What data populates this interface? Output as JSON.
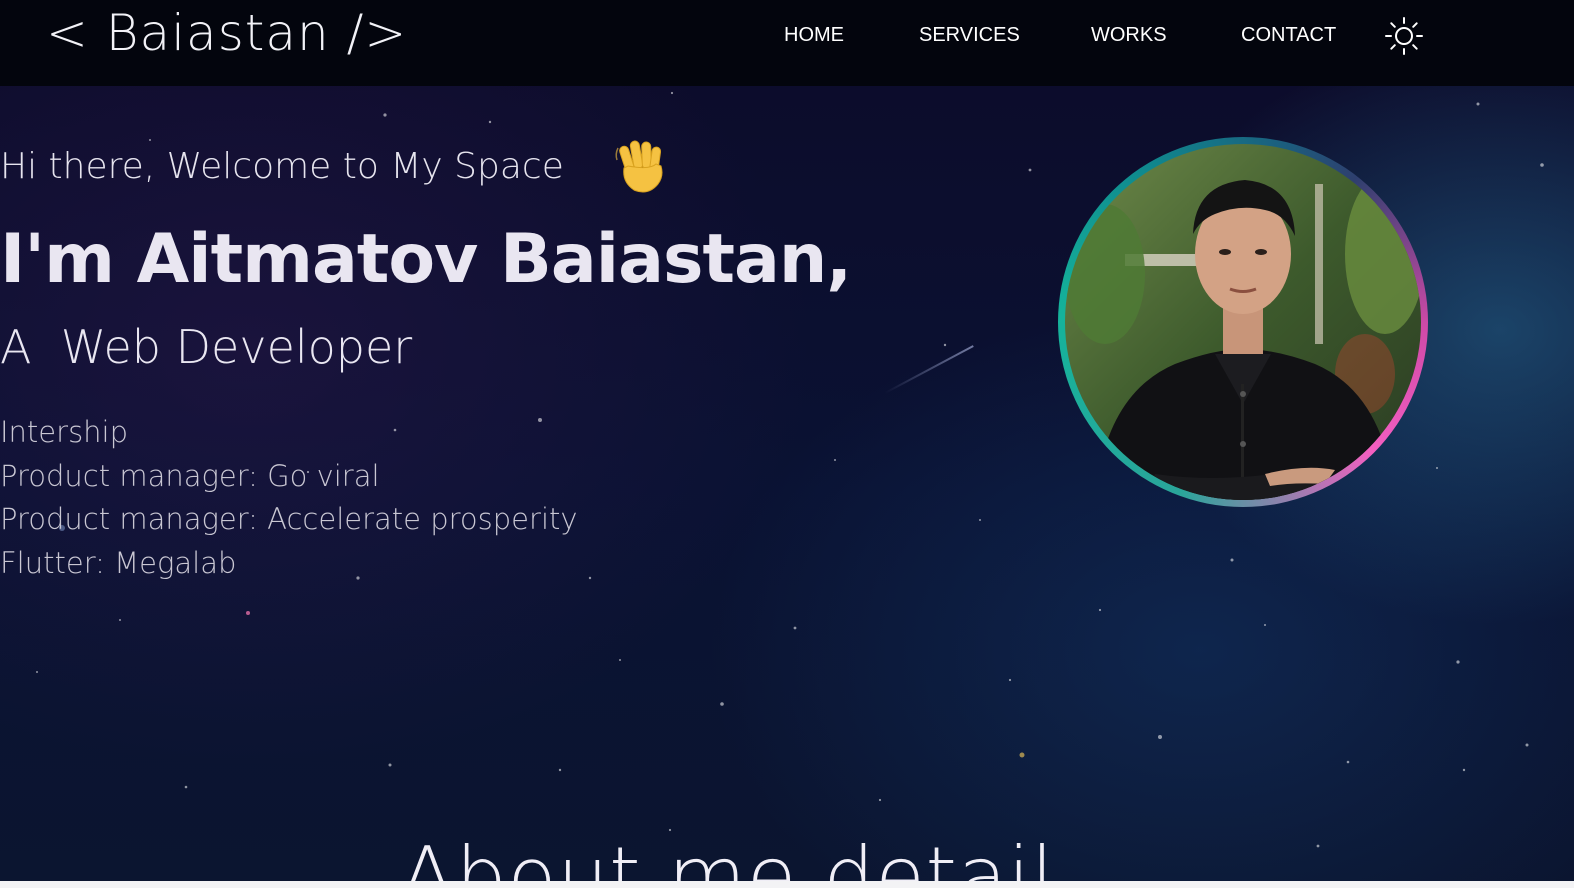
{
  "header": {
    "logo": "< Baiastan />",
    "nav": {
      "home": "HOME",
      "services": "SERVICES",
      "works": "WORKS",
      "contact": "CONTACT"
    },
    "theme_toggle_icon": "sun-icon"
  },
  "hero": {
    "greeting": "Hi there, Welcome to My Space",
    "greeting_icon": "waving-hand-icon",
    "name": "I'm Aitmatov Baiastan,",
    "role": "A  Web Developer",
    "experience": [
      "Intership",
      "Product manager: Go viral",
      "Product manager: Accelerate prosperity",
      "Flutter: Megalab"
    ],
    "avatar_icon": "profile-photo"
  },
  "about": {
    "heading": "About me detail"
  },
  "colors": {
    "nav_background": "#03050d",
    "text_primary": "#e9e6f1",
    "text_secondary": "#c9c7d3",
    "avatar_ring_pink": "#f45fc1",
    "avatar_ring_teal": "#15b39b"
  }
}
